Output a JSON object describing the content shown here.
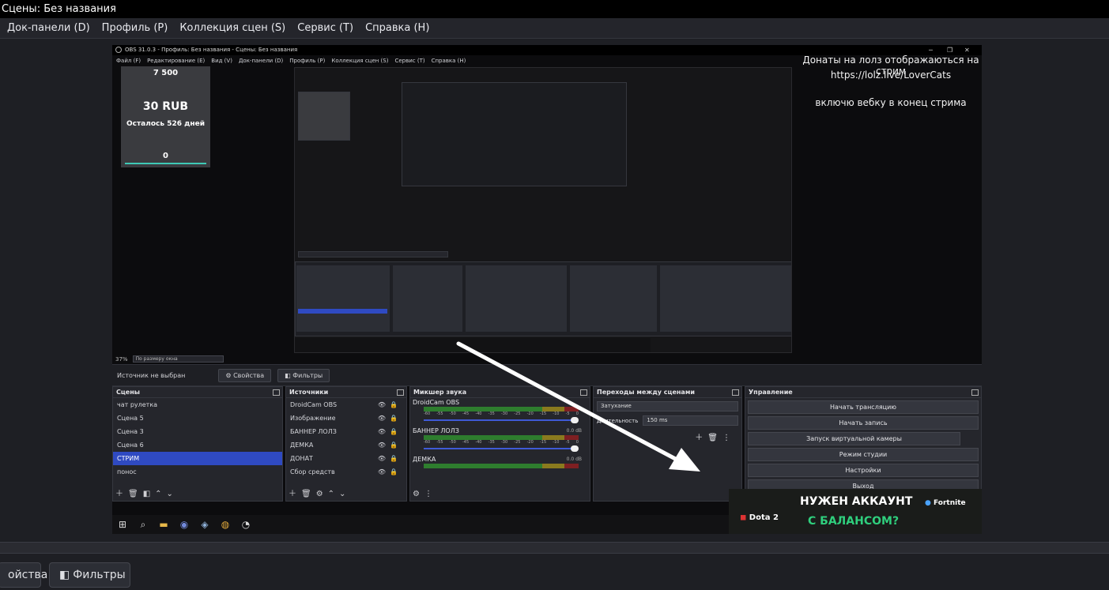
{
  "window": {
    "title": "Сцены: Без названия"
  },
  "menu": [
    "Док-панели (D)",
    "Профиль (P)",
    "Коллекция сцен (S)",
    "Сервис (T)",
    "Справка (H)"
  ],
  "bottom": {
    "properties": "ойства",
    "filters": "Фильтры"
  },
  "inner": {
    "title": "OBS 31.0.3 - Профиль: Без названия - Сцены: Без названия",
    "menu": [
      "Файл (F)",
      "Редактирование (E)",
      "Вид (V)",
      "Док-панели (D)",
      "Профиль (P)",
      "Коллекция сцен (S)",
      "Сервис (T)",
      "Справка (H)"
    ],
    "overlay": {
      "line1": "Донаты на лолз отображаються на стрим",
      "line2": "https://lolz.live/LoverCats",
      "line3": "включю вебку в конец стрима"
    },
    "donate": {
      "top": "7 500",
      "amount": "30 RUB",
      "remain": "Осталось 526 дней",
      "bottom": "0"
    },
    "zoom": {
      "percent": "37%",
      "mode": "По размеру окна"
    },
    "source_strip": {
      "label": "Источник не выбран",
      "props": "Свойства",
      "filters": "Фильтры"
    },
    "docks": {
      "scenes": {
        "title": "Сцены",
        "items": [
          "чат рулетка",
          "Сцена 5",
          "Сцена 3",
          "Сцена 6",
          "СТРИМ",
          "понос"
        ],
        "active": 4
      },
      "sources": {
        "title": "Источники",
        "items": [
          "DroidCam OBS",
          "Изображение",
          "БАННЕР ЛОЛЗ",
          "ДЕМКА",
          "ДОНАТ",
          "Сбор средств"
        ]
      },
      "mixer": {
        "title": "Микшер звука",
        "channels": [
          {
            "name": "DroidCam OBS",
            "db": ""
          },
          {
            "name": "БАННЕР ЛОЛЗ",
            "db": "0.0 dB"
          },
          {
            "name": "ДЕМКА",
            "db": "0.0 dB"
          }
        ],
        "ticks": [
          "-60",
          "-55",
          "-50",
          "-45",
          "-40",
          "-35",
          "-30",
          "-25",
          "-20",
          "-15",
          "-10",
          "-5",
          "0"
        ]
      },
      "transitions": {
        "title": "Переходы между сценами",
        "type": "Затухание",
        "duration_label": "Длительность",
        "duration": "150 ms"
      },
      "controls": {
        "title": "Управление",
        "buttons": [
          "Начать трансляцию",
          "Начать запись",
          "Запуск виртуальной камеры",
          "Режим студии",
          "Настройки",
          "Выход"
        ]
      }
    },
    "banner": {
      "line1": "НУЖЕН АККАУНТ",
      "line2": "С БАЛАНСОМ?",
      "game1": "Dota 2",
      "game2": "Fortnite"
    }
  }
}
